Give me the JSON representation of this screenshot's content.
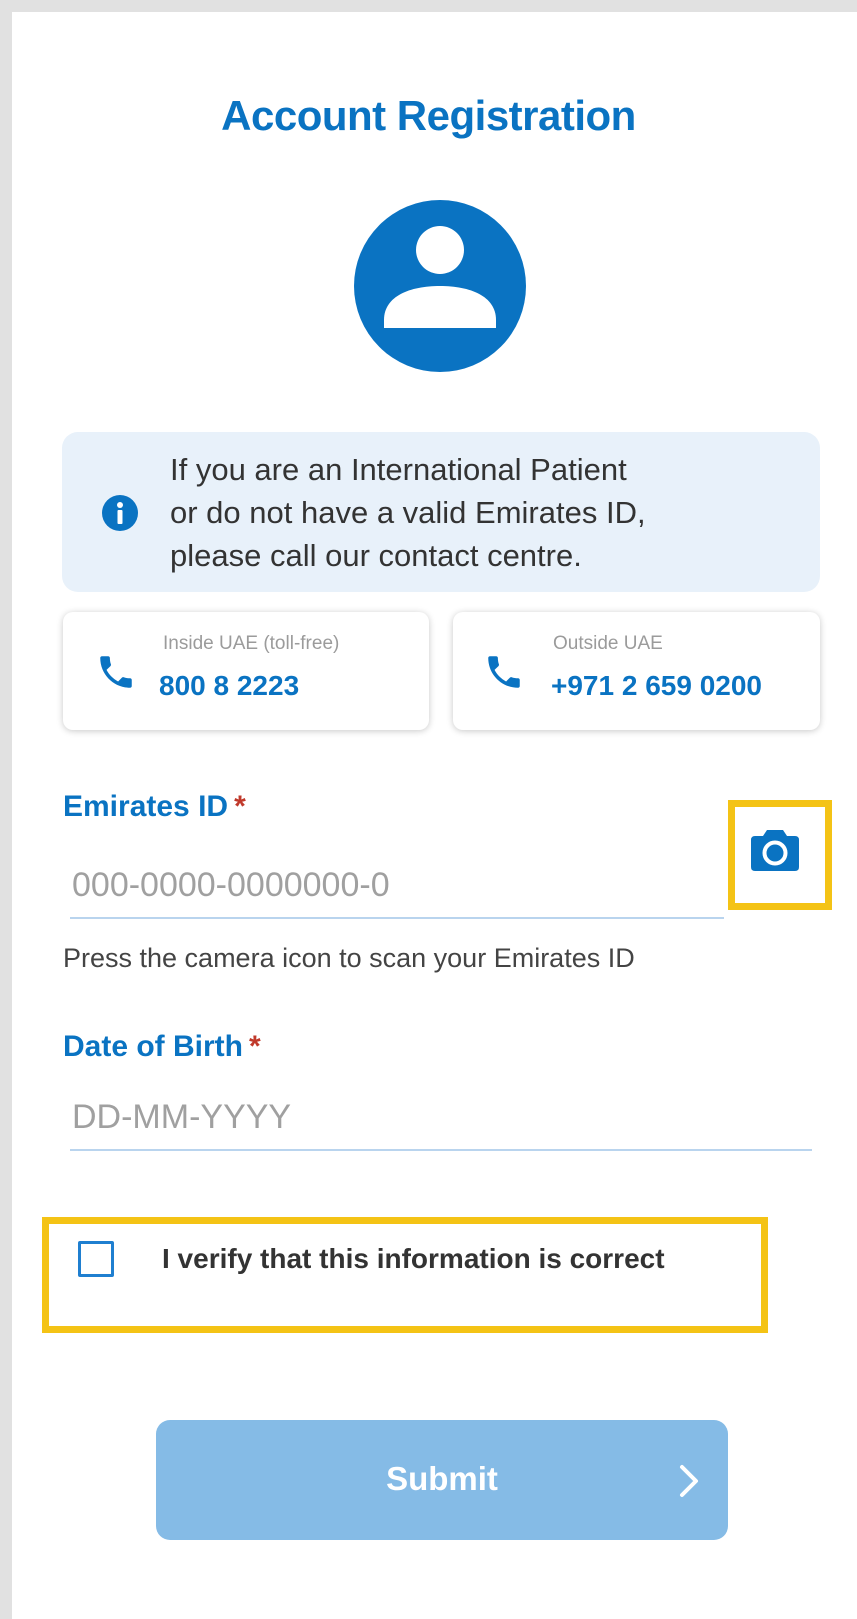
{
  "header": {
    "title": "Account Registration"
  },
  "avatar": {
    "icon": "user-avatar-icon",
    "color": "#0a73c2"
  },
  "info_banner": {
    "icon": "info-icon",
    "text_line1": "If you are an International Patient",
    "text_line2": "or do not have a valid Emirates ID,",
    "text_line3": "please call our contact centre."
  },
  "contacts": [
    {
      "icon": "phone-icon",
      "caption": "Inside UAE (toll-free)",
      "number": "800 8 2223"
    },
    {
      "icon": "phone-icon",
      "caption": "Outside UAE",
      "number": "+971 2 659 0200"
    }
  ],
  "form": {
    "emirates_id": {
      "label": "Emirates ID",
      "required_mark": "*",
      "placeholder": "000-0000-0000000-0",
      "value": "",
      "helper": "Press the camera icon to scan your Emirates ID",
      "camera_icon": "camera-icon"
    },
    "dob": {
      "label": "Date of Birth",
      "required_mark": "*",
      "placeholder": "DD-MM-YYYY",
      "value": ""
    },
    "verify": {
      "label": "I verify that this information is correct",
      "checked": false
    },
    "submit": {
      "label": "Submit",
      "icon": "chevron-right-icon"
    }
  },
  "colors": {
    "primary": "#0a73c2",
    "info_background": "#e8f1fa",
    "required": "#c0392b",
    "highlight": "#f4c315",
    "submit_disabled": "#85bbe6"
  }
}
